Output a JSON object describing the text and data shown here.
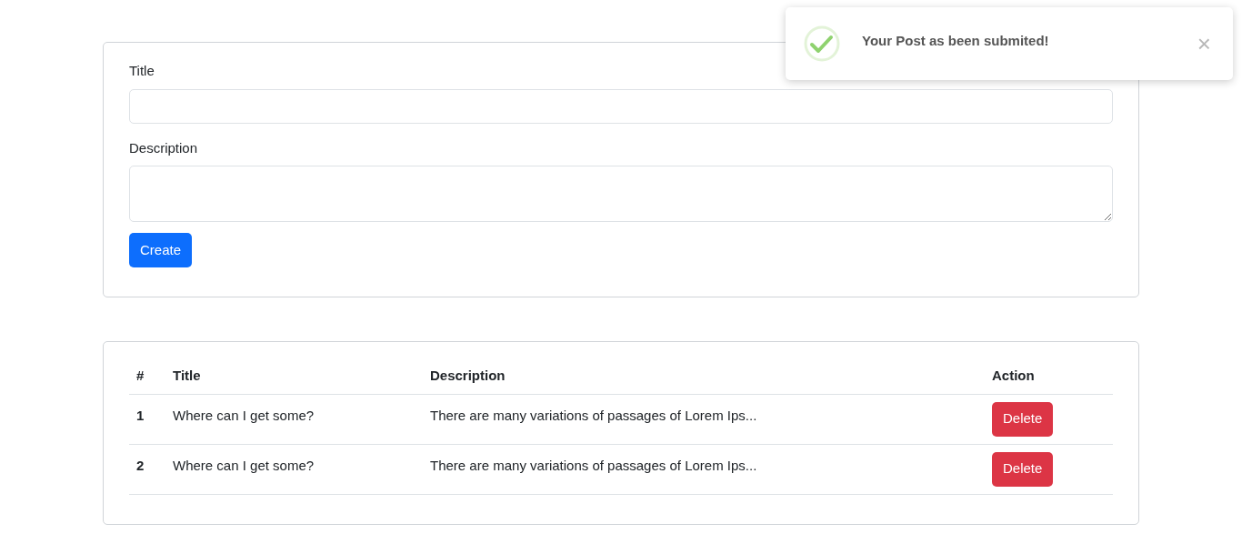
{
  "form": {
    "fields": [
      {
        "kind": "input",
        "label": "Title"
      },
      {
        "kind": "textarea",
        "label": "Description"
      }
    ],
    "submit": "Create"
  },
  "table": {
    "columns": [
      "#",
      "Title",
      "Description",
      "Action"
    ],
    "rows": [
      {
        "index": "1",
        "title": "Where can I get some?",
        "description": "There are many variations of passages of Lorem Ips...",
        "action": "Delete"
      },
      {
        "index": "2",
        "title": "Where can I get some?",
        "description": "There are many variations of passages of Lorem Ips...",
        "action": "Delete"
      }
    ]
  },
  "toast": {
    "message": "Your Post as been submited!",
    "close": "×"
  }
}
